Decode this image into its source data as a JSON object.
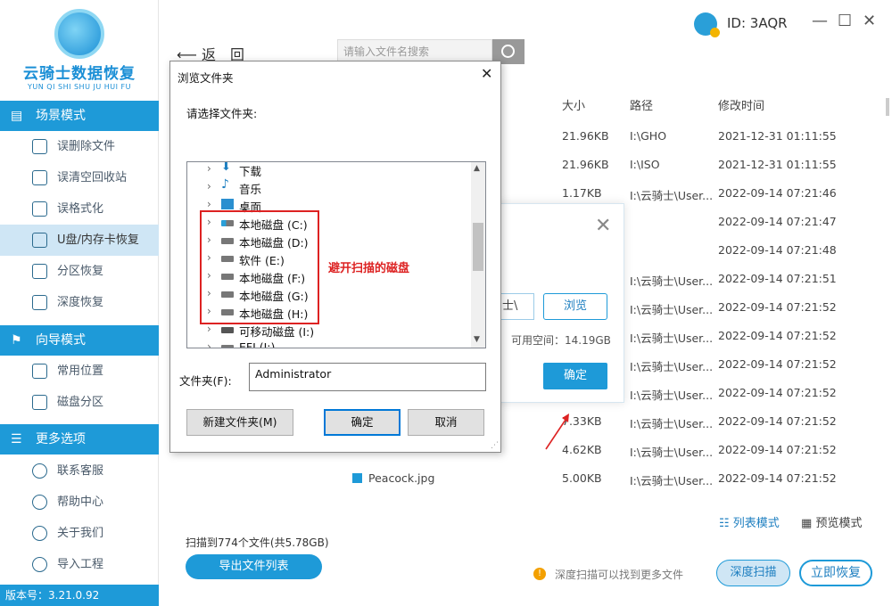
{
  "app": {
    "title": "云骑士数据恢复",
    "subtitle": "YUN QI SHI SHU JU HUI FU",
    "version": "版本号：3.21.0.92",
    "user_id": "ID: 3AQR"
  },
  "sidebar": {
    "sections": [
      {
        "title": "场景模式",
        "items": [
          {
            "label": "误删除文件"
          },
          {
            "label": "误清空回收站"
          },
          {
            "label": "误格式化"
          },
          {
            "label": "U盘/内存卡恢复",
            "active": true
          },
          {
            "label": "分区恢复"
          },
          {
            "label": "深度恢复"
          }
        ]
      },
      {
        "title": "向导模式",
        "items": [
          {
            "label": "常用位置"
          },
          {
            "label": "磁盘分区"
          }
        ]
      },
      {
        "title": "更多选项",
        "items": [
          {
            "label": "联系客服"
          },
          {
            "label": "帮助中心"
          },
          {
            "label": "关于我们"
          },
          {
            "label": "导入工程"
          }
        ]
      }
    ]
  },
  "toolbar": {
    "back_label": "返　回",
    "search_placeholder": "请输入文件名搜索"
  },
  "table": {
    "headers": [
      "大小",
      "路径",
      "修改时间"
    ],
    "rows": [
      {
        "size": "21.96KB",
        "path": "I:\\GHO",
        "time": "2021-12-31 01:11:55"
      },
      {
        "size": "21.96KB",
        "path": "I:\\ISO",
        "time": "2021-12-31 01:11:55"
      },
      {
        "size": "1.17KB",
        "path": "I:\\云骑士\\User...",
        "time": "2022-09-14 07:21:46"
      },
      {
        "size": "",
        "path": "",
        "time": "2022-09-14 07:21:47"
      },
      {
        "size": "",
        "path": "",
        "time": "2022-09-14 07:21:48"
      },
      {
        "size": "",
        "path": "I:\\云骑士\\User...",
        "time": "2022-09-14 07:21:51"
      },
      {
        "size": "",
        "path": "I:\\云骑士\\User...",
        "time": "2022-09-14 07:21:52"
      },
      {
        "size": "",
        "path": "I:\\云骑士\\User...",
        "time": "2022-09-14 07:21:52"
      },
      {
        "size": "",
        "path": "I:\\云骑士\\User...",
        "time": "2022-09-14 07:21:52"
      },
      {
        "size": "",
        "path": "I:\\云骑士\\User...",
        "time": "2022-09-14 07:21:52"
      },
      {
        "size": "7.33KB",
        "path": "I:\\云骑士\\User...",
        "time": "2022-09-14 07:21:52"
      },
      {
        "size": "4.62KB",
        "path": "I:\\云骑士\\User...",
        "time": "2022-09-14 07:21:52"
      },
      {
        "name": "Peacock.jpg",
        "size": "5.00KB",
        "path": "I:\\云骑士\\User...",
        "time": "2022-09-14 07:21:52"
      }
    ]
  },
  "footer": {
    "scan_summary": "扫描到774个文件(共5.78GB)",
    "export_label": "导出文件列表",
    "list_mode": "列表模式",
    "preview_mode": "预览模式",
    "hint": "深度扫描可以找到更多文件",
    "deep_scan": "深度扫描",
    "recover_now": "立即恢复"
  },
  "popup": {
    "path_fragment": "士\\",
    "browse": "浏览",
    "free_space": "可用空间：14.19GB",
    "ok": "确定"
  },
  "dialog": {
    "title": "浏览文件夹",
    "prompt": "请选择文件夹:",
    "tree": [
      {
        "label": "下载",
        "icon": "download-icon"
      },
      {
        "label": "音乐",
        "icon": "music-icon"
      },
      {
        "label": "桌面",
        "icon": "desktop-icon"
      },
      {
        "label": "本地磁盘 (C:)",
        "icon": "windows-drive-icon"
      },
      {
        "label": "本地磁盘 (D:)",
        "icon": "drive-icon"
      },
      {
        "label": "软件 (E:)",
        "icon": "drive-icon"
      },
      {
        "label": "本地磁盘 (F:)",
        "icon": "drive-icon"
      },
      {
        "label": "本地磁盘 (G:)",
        "icon": "drive-icon"
      },
      {
        "label": "本地磁盘 (H:)",
        "icon": "drive-icon"
      },
      {
        "label": "可移动磁盘 (I:)",
        "icon": "usb-drive-icon"
      },
      {
        "label": "EFI (J:)",
        "icon": "drive-icon"
      }
    ],
    "annotation": "避开扫描的磁盘",
    "folder_label": "文件夹(F):",
    "folder_value": "Administrator",
    "new_folder": "新建文件夹(M)",
    "ok": "确定",
    "cancel": "取消"
  },
  "colors": {
    "accent": "#1e9ad8",
    "annotation": "#dd2222"
  }
}
